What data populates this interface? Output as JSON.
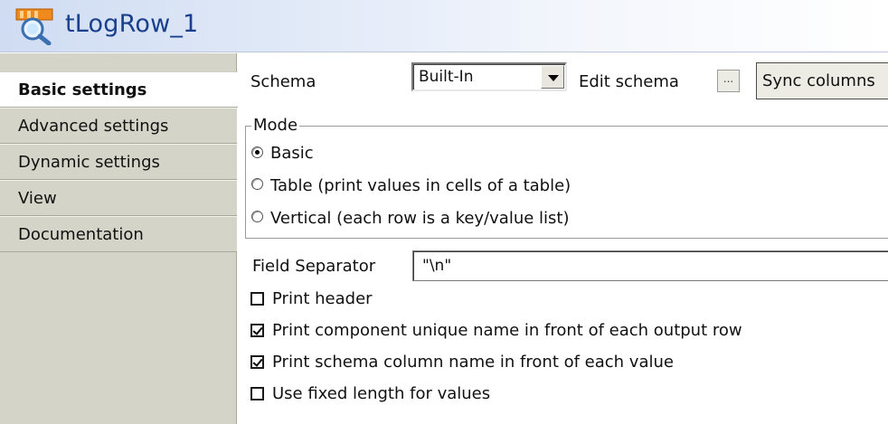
{
  "window": {
    "title": "tLogRow_1",
    "icon": "log-row-component-icon"
  },
  "sidebar": {
    "items": [
      {
        "label": "Basic settings",
        "active": true
      },
      {
        "label": "Advanced settings",
        "active": false
      },
      {
        "label": "Dynamic settings",
        "active": false
      },
      {
        "label": "View",
        "active": false
      },
      {
        "label": "Documentation",
        "active": false
      }
    ]
  },
  "schema": {
    "label": "Schema",
    "selected": "Built-In",
    "edit_label": "Edit schema",
    "edit_button": "...",
    "sync_button": "Sync columns"
  },
  "mode": {
    "legend": "Mode",
    "options": [
      {
        "label": "Basic",
        "selected": true
      },
      {
        "label": "Table (print values in cells of a table)",
        "selected": false
      },
      {
        "label": "Vertical (each row is a key/value list)",
        "selected": false
      }
    ]
  },
  "field_separator": {
    "label": "Field Separator",
    "value": "\"\\n\""
  },
  "options": [
    {
      "label": "Print header",
      "checked": false
    },
    {
      "label": "Print component unique name in front of each output row",
      "checked": true
    },
    {
      "label": "Print schema column name in front of each value",
      "checked": true
    },
    {
      "label": "Use fixed length for values",
      "checked": false
    }
  ],
  "colors": {
    "title_text": "#1a3f8c",
    "sidebar_bg": "#d4d4c8",
    "active_tab_bg": "#ffffff"
  }
}
